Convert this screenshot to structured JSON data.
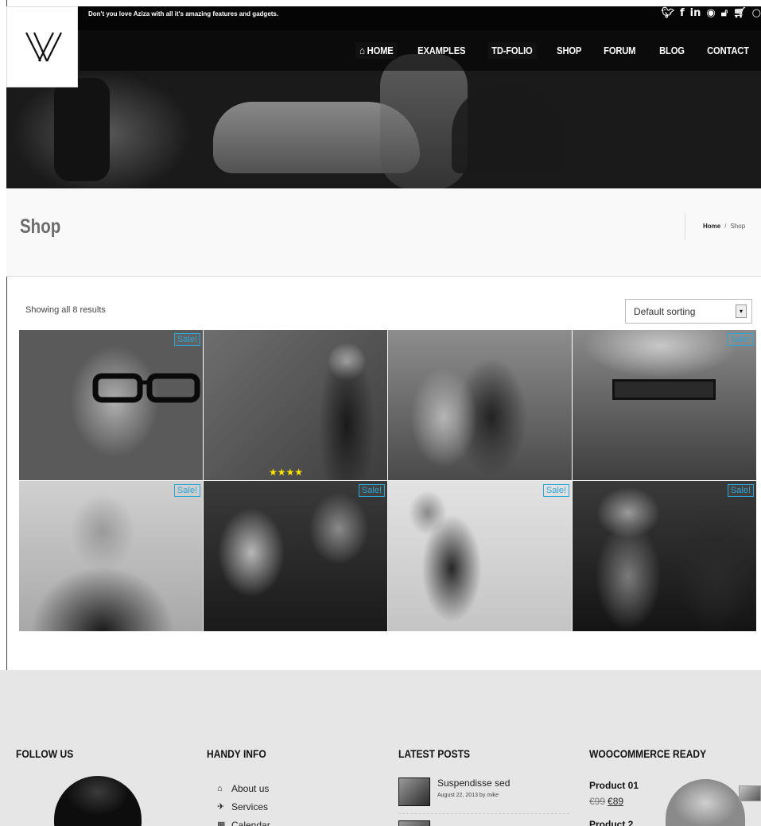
{
  "header": {
    "tagline": "Don't you love Aziza with all it's amazing features and gadgets.",
    "social_icons": [
      "twitter-icon",
      "facebook-icon",
      "linkedin-icon",
      "dribbble-icon",
      "lock-icon",
      "cart-icon"
    ],
    "nav": [
      {
        "label": "HOME",
        "icon": "home-icon",
        "active": true
      },
      {
        "label": "EXAMPLES"
      },
      {
        "label": "TD-FOLIO",
        "active": true
      },
      {
        "label": "SHOP"
      },
      {
        "label": "FORUM"
      },
      {
        "label": "BLOG"
      },
      {
        "label": "CONTACT"
      }
    ]
  },
  "title_bar": {
    "title": "Shop",
    "breadcrumb": {
      "home": "Home",
      "separator": "/",
      "current": "Shop"
    }
  },
  "shop": {
    "result_count": "Showing all 8 results",
    "sort_selected": "Default sorting",
    "products": [
      {
        "sale_label": "Sale!"
      },
      {
        "rating_stars": 4
      },
      {},
      {
        "sale_label": "Sale!"
      },
      {
        "sale_label": "Sale!"
      },
      {
        "sale_label": "Sale!"
      },
      {
        "sale_label": "Sale!"
      },
      {
        "sale_label": "Sale!"
      }
    ]
  },
  "footer": {
    "follow_us": {
      "heading": "FOLLOW US"
    },
    "handy_info": {
      "heading": "HANDY INFO",
      "items": [
        {
          "label": "About us",
          "icon": "home-icon"
        },
        {
          "label": "Services",
          "icon": "rocket-icon"
        },
        {
          "label": "Calendar",
          "icon": "calendar-icon"
        }
      ]
    },
    "latest_posts": {
      "heading": "LATEST POSTS",
      "posts": [
        {
          "title": "Suspendisse sed",
          "date": "August 22, 2013 by",
          "author": "mike"
        }
      ]
    },
    "woocommerce": {
      "heading": "WOOCOMMERCE READY",
      "products": [
        {
          "name": "Product 01",
          "old_price": "€99",
          "new_price": "€89"
        },
        {
          "name": "Product 2"
        }
      ]
    }
  }
}
